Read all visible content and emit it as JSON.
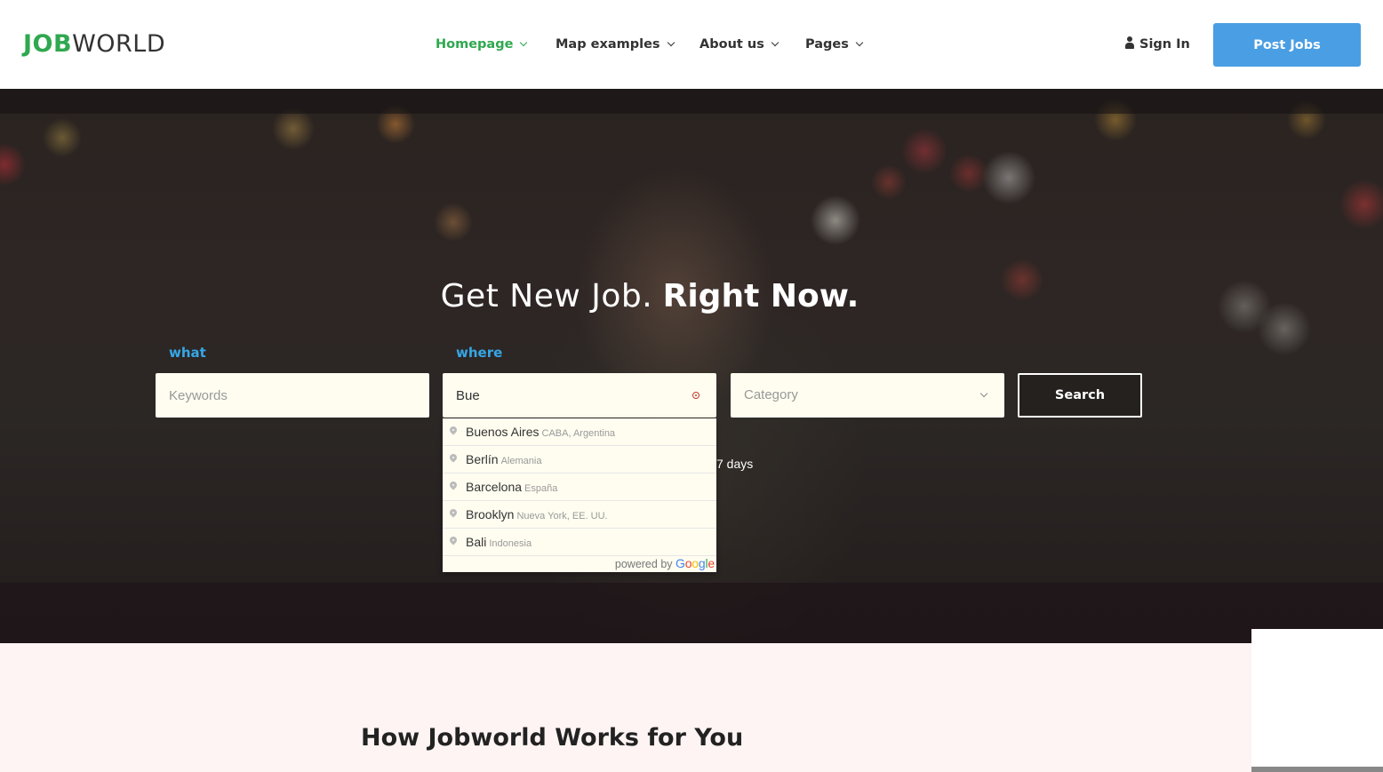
{
  "logo": {
    "part1": "JOB",
    "part2": "WORLD"
  },
  "nav": {
    "items": [
      {
        "label": "Homepage",
        "active": true
      },
      {
        "label": "Map examples",
        "active": false
      },
      {
        "label": "About us",
        "active": false
      },
      {
        "label": "Pages",
        "active": false
      }
    ]
  },
  "header": {
    "signin_label": "Sign In",
    "post_jobs_label": "Post Jobs"
  },
  "hero": {
    "headline_thin": "Get New Job.",
    "headline_bold": "Right Now.",
    "what_label": "what",
    "where_label": "where",
    "keywords_placeholder": "Keywords",
    "where_value": "Bue",
    "category_placeholder": "Category",
    "search_label": "Search",
    "days_text": "7 days"
  },
  "autocomplete": {
    "items": [
      {
        "main": "Buenos Aires",
        "secondary": "CABA, Argentina"
      },
      {
        "main": "Berlín",
        "secondary": "Alemania"
      },
      {
        "main": "Barcelona",
        "secondary": "España"
      },
      {
        "main": "Brooklyn",
        "secondary": "Nueva York, EE. UU."
      },
      {
        "main": "Bali",
        "secondary": "Indonesia"
      }
    ],
    "powered_by": "powered by",
    "google": [
      "G",
      "o",
      "o",
      "g",
      "l",
      "e"
    ]
  },
  "section": {
    "title": "How Jobworld Works for You"
  },
  "colors": {
    "brand_green": "#2fa84f",
    "accent_blue": "#4a9ee3",
    "label_blue": "#36a6e6"
  },
  "icons": [
    "chevron-down-icon",
    "user-icon",
    "target-icon",
    "map-pin-icon"
  ]
}
